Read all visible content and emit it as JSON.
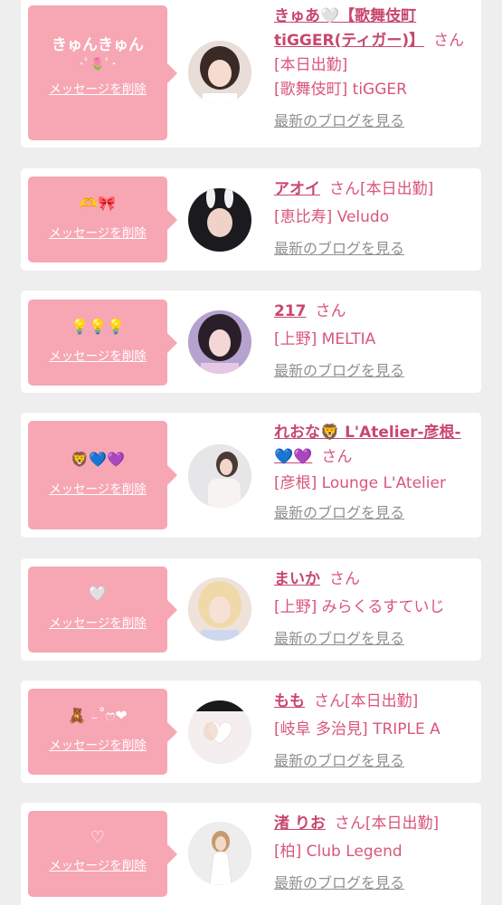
{
  "theme": {
    "accent": "#f7a6b4",
    "name_color": "#c8476d",
    "text_pink": "#d95679",
    "link_gray": "#8f8f8f",
    "page_bg": "#eeeeee"
  },
  "cards": [
    {
      "bubble_text": "きゅんきゅん",
      "bubble_emoji": "･ﾟ🌷ﾟ･",
      "delete_label": "メッセージを削除",
      "name": "きゅあ🤍【歌舞伎町tiGGER(ティガー)】",
      "suffix": "さん[本日出勤]",
      "shop": "[歌舞伎町] tiGGER",
      "blog_link": "最新のブログを見る",
      "avatar_icon": "girl-photo-avatar"
    },
    {
      "bubble_text": "",
      "bubble_emoji": "🫶🎀",
      "delete_label": "メッセージを削除",
      "name": "アオイ",
      "suffix": "さん[本日出勤]",
      "shop": "[恵比寿] Veludo",
      "blog_link": "最新のブログを見る",
      "avatar_icon": "girl-photo-avatar"
    },
    {
      "bubble_text": "",
      "bubble_emoji": "💡💡💡",
      "delete_label": "メッセージを削除",
      "name": "217",
      "suffix": "さん",
      "shop": "[上野] MELTIA",
      "blog_link": "最新のブログを見る",
      "avatar_icon": "girl-photo-avatar"
    },
    {
      "bubble_text": "",
      "bubble_emoji": "🦁💙💜",
      "delete_label": "メッセージを削除",
      "name": "れおな🦁 L'Atelier-彦根-💙💜",
      "suffix": "さん",
      "shop": "[彦根] Lounge L'Atelier",
      "blog_link": "最新のブログを見る",
      "avatar_icon": "girl-photo-avatar"
    },
    {
      "bubble_text": "",
      "bubble_emoji": "🤍",
      "delete_label": "メッセージを削除",
      "name": "まいか",
      "suffix": "さん",
      "shop": "[上野] みらくるすていじ",
      "blog_link": "最新のブログを見る",
      "avatar_icon": "girl-photo-avatar"
    },
    {
      "bubble_text": "",
      "bubble_emoji": "🧸 ₋˚ෆ❤",
      "delete_label": "メッセージを削除",
      "name": "もも",
      "suffix": "さん[本日出勤]",
      "shop": "[岐阜 多治見] TRIPLE A",
      "blog_link": "最新のブログを見る",
      "avatar_icon": "girl-photo-avatar"
    },
    {
      "bubble_text": "",
      "bubble_emoji": "♡",
      "delete_label": "メッセージを削除",
      "name": "渚 りお",
      "suffix": "さん[本日出勤]",
      "shop": "[柏] Club Legend",
      "blog_link": "最新のブログを見る",
      "avatar_icon": "girl-photo-avatar"
    }
  ]
}
